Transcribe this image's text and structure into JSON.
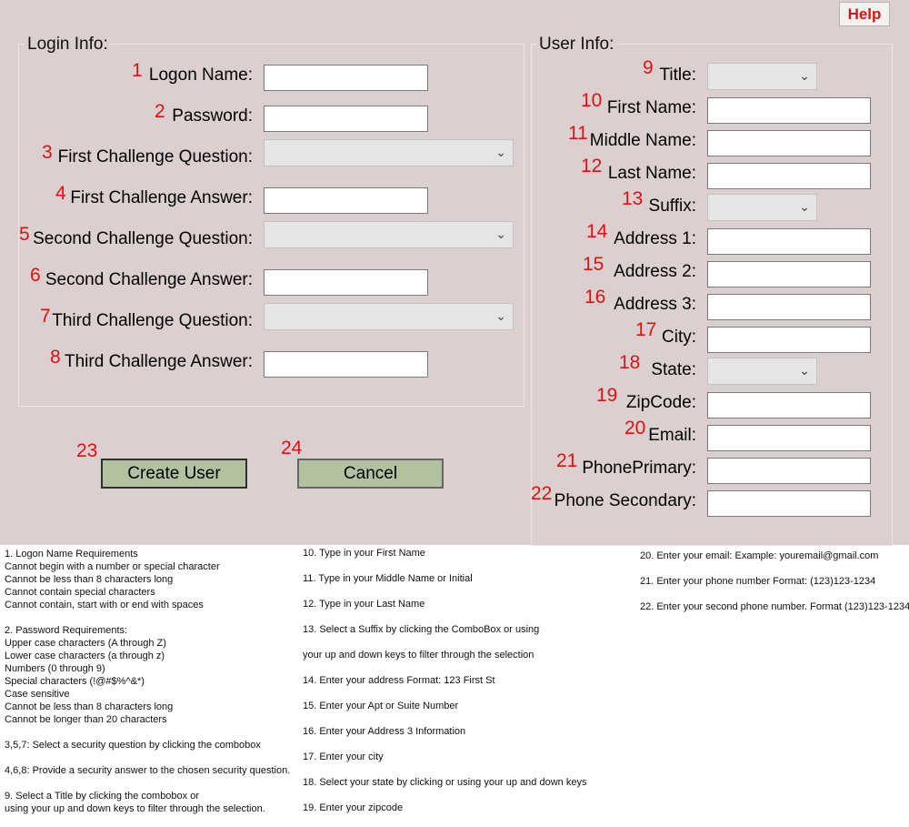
{
  "help_button": "Help",
  "login": {
    "title": "Login Info:",
    "fields": [
      {
        "num": "1",
        "label": "Logon Name:",
        "type": "text"
      },
      {
        "num": "2",
        "label": "Password:",
        "type": "text"
      },
      {
        "num": "3",
        "label": "First Challenge Question:",
        "type": "combo"
      },
      {
        "num": "4",
        "label": "First Challenge Answer:",
        "type": "text"
      },
      {
        "num": "5",
        "label": "Second Challenge Question:",
        "type": "combo"
      },
      {
        "num": "6",
        "label": "Second Challenge Answer:",
        "type": "text"
      },
      {
        "num": "7",
        "label": "Third Challenge Question:",
        "type": "combo"
      },
      {
        "num": "8",
        "label": "Third Challenge Answer:",
        "type": "text"
      }
    ]
  },
  "user": {
    "title": "User Info:",
    "fields": [
      {
        "num": "9",
        "label": "Title:",
        "type": "combo"
      },
      {
        "num": "10",
        "label": "First Name:",
        "type": "text"
      },
      {
        "num": "11",
        "label": "Middle Name:",
        "type": "text"
      },
      {
        "num": "12",
        "label": "Last Name:",
        "type": "text"
      },
      {
        "num": "13",
        "label": "Suffix:",
        "type": "combo"
      },
      {
        "num": "14",
        "label": "Address 1:",
        "type": "text"
      },
      {
        "num": "15",
        "label": "Address 2:",
        "type": "text"
      },
      {
        "num": "16",
        "label": "Address 3:",
        "type": "text"
      },
      {
        "num": "17",
        "label": "City:",
        "type": "text"
      },
      {
        "num": "18",
        "label": "State:",
        "type": "combo"
      },
      {
        "num": "19",
        "label": "ZipCode:",
        "type": "text"
      },
      {
        "num": "20",
        "label": "Email:",
        "type": "text"
      },
      {
        "num": "21",
        "label": "PhonePrimary:",
        "type": "text"
      },
      {
        "num": "22",
        "label": "Phone Secondary:",
        "type": "text"
      }
    ]
  },
  "buttons": {
    "create": {
      "num": "23",
      "label": "Create User"
    },
    "cancel": {
      "num": "24",
      "label": "Cancel"
    }
  },
  "help_text": {
    "col1": [
      "1. Logon Name Requirements",
      "Cannot begin with a number or special character",
      "Cannot be less than 8 characters long",
      "Cannot contain special characters",
      "Cannot contain, start with or end with spaces",
      "",
      "2. Password Requirements:",
      "Upper case characters (A through Z)",
      "Lower case characters (a through z)",
      "Numbers (0 through 9)",
      "Special characters (!@#$%^&*)",
      "Case sensitive",
      "Cannot be less than 8 characters long",
      "Cannot be longer than 20 characters",
      "",
      "3,5,7: Select a security question by clicking the combobox",
      "",
      "4,6,8: Provide a security answer to the chosen security question.",
      "",
      "9. Select a Title by clicking the combobox or",
      "using your up and down keys to filter through the selection."
    ],
    "col2": [
      "10. Type in your First Name",
      "11. Type in your Middle Name or Initial",
      "12. Type in your Last Name",
      "13. Select a Suffix by clicking the ComboBox or using",
      "your up and down keys to filter through the selection",
      "14. Enter your address Format: 123 First St",
      "15. Enter your Apt or Suite Number",
      "16. Enter your Address 3 Information",
      "17. Enter your city",
      "18. Select your state by clicking or using your up and down keys",
      "19. Enter your zipcode"
    ],
    "col3": [
      "20. Enter your email: Example: youremail@gmail.com",
      "21. Enter your phone number Format: (123)123-1234",
      "22. Enter your second phone number. Format (123)123-1234"
    ]
  }
}
